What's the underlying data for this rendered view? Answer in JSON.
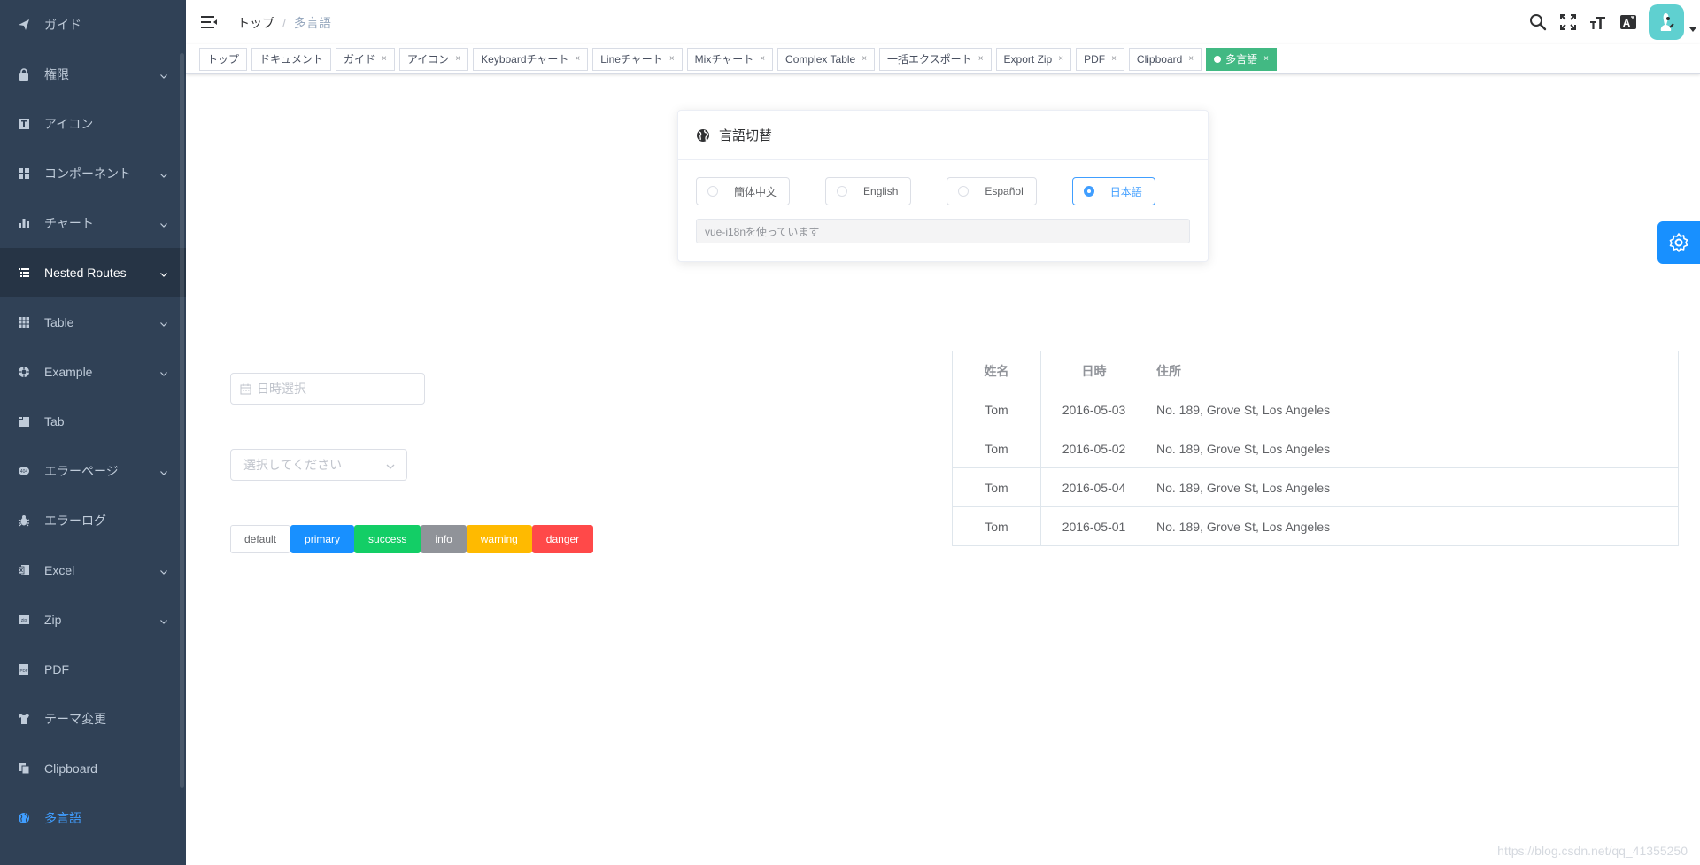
{
  "sidebar": {
    "items": [
      {
        "label": "ガイド",
        "icon": "guide-icon",
        "has_children": false
      },
      {
        "label": "権限",
        "icon": "lock-icon",
        "has_children": true
      },
      {
        "label": "アイコン",
        "icon": "icon-icon",
        "has_children": false
      },
      {
        "label": "コンポーネント",
        "icon": "component-icon",
        "has_children": true
      },
      {
        "label": "チャート",
        "icon": "chart-icon",
        "has_children": true
      },
      {
        "label": "Nested Routes",
        "icon": "nested-icon",
        "has_children": true
      },
      {
        "label": "Table",
        "icon": "table-icon",
        "has_children": true
      },
      {
        "label": "Example",
        "icon": "example-icon",
        "has_children": true
      },
      {
        "label": "Tab",
        "icon": "tab-icon",
        "has_children": false
      },
      {
        "label": "エラーページ",
        "icon": "error-page-icon",
        "has_children": true
      },
      {
        "label": "エラーログ",
        "icon": "bug-icon",
        "has_children": false
      },
      {
        "label": "Excel",
        "icon": "excel-icon",
        "has_children": true
      },
      {
        "label": "Zip",
        "icon": "zip-icon",
        "has_children": true
      },
      {
        "label": "PDF",
        "icon": "pdf-icon",
        "has_children": false
      },
      {
        "label": "テーマ変更",
        "icon": "theme-icon",
        "has_children": false
      },
      {
        "label": "Clipboard",
        "icon": "clipboard-icon",
        "has_children": false
      },
      {
        "label": "多言語",
        "icon": "international-icon",
        "has_children": false
      }
    ]
  },
  "navbar": {
    "breadcrumb_home": "トップ",
    "breadcrumb_separator": "/",
    "breadcrumb_current": "多言語"
  },
  "tags": [
    {
      "label": "トップ",
      "closable": false,
      "active": false
    },
    {
      "label": "ドキュメント",
      "closable": false,
      "active": false
    },
    {
      "label": "ガイド",
      "closable": true,
      "active": false
    },
    {
      "label": "アイコン",
      "closable": true,
      "active": false
    },
    {
      "label": "Keyboardチャート",
      "closable": true,
      "active": false
    },
    {
      "label": "Lineチャート",
      "closable": true,
      "active": false
    },
    {
      "label": "Mixチャート",
      "closable": true,
      "active": false
    },
    {
      "label": "Complex Table",
      "closable": true,
      "active": false
    },
    {
      "label": "一括エクスポート",
      "closable": true,
      "active": false
    },
    {
      "label": "Export Zip",
      "closable": true,
      "active": false
    },
    {
      "label": "PDF",
      "closable": true,
      "active": false
    },
    {
      "label": "Clipboard",
      "closable": true,
      "active": false
    },
    {
      "label": "多言語",
      "closable": true,
      "active": true
    }
  ],
  "tag_close_glyph": "×",
  "lang_card": {
    "title": "言語切替",
    "options": [
      {
        "label": "簡体中文",
        "checked": false
      },
      {
        "label": "English",
        "checked": false
      },
      {
        "label": "Español",
        "checked": false
      },
      {
        "label": "日本語",
        "checked": true
      }
    ],
    "hint": "vue-i18nを使っています"
  },
  "date_picker": {
    "placeholder": "日時選択"
  },
  "select": {
    "placeholder": "選択してください"
  },
  "buttons": [
    {
      "label": "default",
      "type": "default"
    },
    {
      "label": "primary",
      "type": "primary"
    },
    {
      "label": "success",
      "type": "success"
    },
    {
      "label": "info",
      "type": "info"
    },
    {
      "label": "warning",
      "type": "warning"
    },
    {
      "label": "danger",
      "type": "danger"
    }
  ],
  "table": {
    "headers": [
      "姓名",
      "日時",
      "住所"
    ],
    "rows": [
      [
        "Tom",
        "2016-05-03",
        "No. 189, Grove St, Los Angeles"
      ],
      [
        "Tom",
        "2016-05-02",
        "No. 189, Grove St, Los Angeles"
      ],
      [
        "Tom",
        "2016-05-04",
        "No. 189, Grove St, Los Angeles"
      ],
      [
        "Tom",
        "2016-05-01",
        "No. 189, Grove St, Los Angeles"
      ]
    ]
  },
  "watermark": "https://blog.csdn.net/qq_41355250",
  "colors": {
    "sidebar_bg": "#304156",
    "sidebar_text": "#bfcbd9",
    "accent": "#409eff",
    "active_tag": "#42b983",
    "primary": "#1890ff",
    "success": "#13ce66",
    "info": "#909399",
    "warning": "#ffba00",
    "danger": "#ff4949"
  }
}
